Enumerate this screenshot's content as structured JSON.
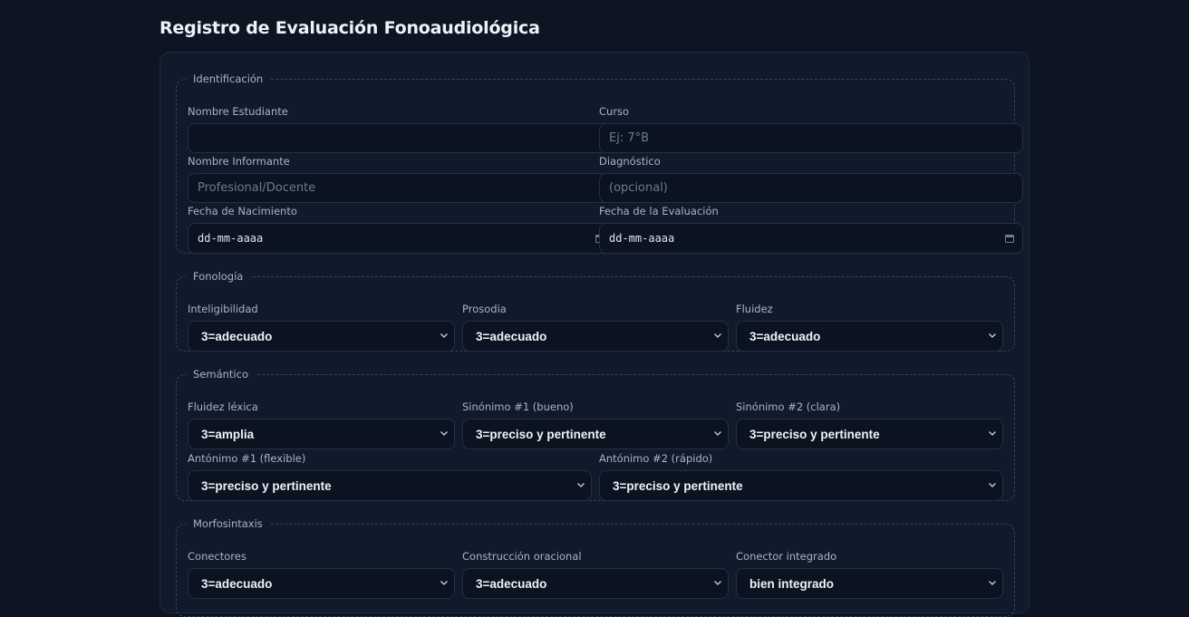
{
  "title": "Registro de Evaluación Fonoaudiológica",
  "identificacion": {
    "legend": "Identificación",
    "nombre_estudiante": {
      "label": "Nombre Estudiante",
      "value": "",
      "placeholder": ""
    },
    "curso": {
      "label": "Curso",
      "placeholder": "Ej: 7°B"
    },
    "nombre_informante": {
      "label": "Nombre Informante",
      "placeholder": "Profesional/Docente"
    },
    "diagnostico": {
      "label": "Diagnóstico",
      "placeholder": "(opcional)"
    },
    "fecha_nacimiento": {
      "label": "Fecha de Nacimiento",
      "value": "dd-mm-aaaa"
    },
    "fecha_evaluacion": {
      "label": "Fecha de la Evaluación",
      "value": "dd-mm-aaaa"
    }
  },
  "fonologia": {
    "legend": "Fonología",
    "inteligibilidad": {
      "label": "Inteligibilidad",
      "value": "3=adecuado"
    },
    "prosodia": {
      "label": "Prosodia",
      "value": "3=adecuado"
    },
    "fluidez": {
      "label": "Fluidez",
      "value": "3=adecuado"
    }
  },
  "semantico": {
    "legend": "Semántico",
    "fluidez_lexica": {
      "label": "Fluidez léxica",
      "value": "3=amplia"
    },
    "sinonimo1": {
      "label": "Sinónimo #1 (bueno)",
      "value": "3=preciso y pertinente"
    },
    "sinonimo2": {
      "label": "Sinónimo #2 (clara)",
      "value": "3=preciso y pertinente"
    },
    "antonimo1": {
      "label": "Antónimo #1 (flexible)",
      "value": "3=preciso y pertinente"
    },
    "antonimo2": {
      "label": "Antónimo #2 (rápido)",
      "value": "3=preciso y pertinente"
    }
  },
  "morfosintaxis": {
    "legend": "Morfosintaxis",
    "conectores": {
      "label": "Conectores",
      "value": "3=adecuado"
    },
    "construccion": {
      "label": "Construcción oracional",
      "value": "3=adecuado"
    },
    "conector_integrado": {
      "label": "Conector integrado",
      "value": "bien integrado"
    }
  },
  "icons": {
    "select": "chevron-down-icon",
    "date": "calendar-icon"
  }
}
